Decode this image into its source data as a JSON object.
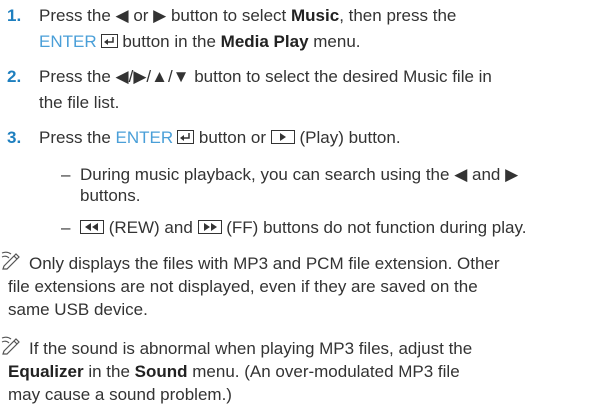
{
  "steps": [
    {
      "number": "1.",
      "line1_a": "Press the ◀ or ▶ button to select ",
      "line1_b": "Music",
      "line1_c": ", then press the",
      "line2_enter": "ENTER",
      "line2_a": " button in the ",
      "line2_b": "Media Play",
      "line2_c": " menu."
    },
    {
      "number": "2.",
      "line1": "Press the ◀/▶/▲/▼ button to select the desired Music file in",
      "line2": "the file list."
    },
    {
      "number": "3.",
      "line1_a": "Press the ",
      "line1_enter": "ENTER",
      "line1_b": " button or ",
      "line1_c": " (Play) button."
    }
  ],
  "sub_bullets": [
    {
      "dash": "–",
      "line1": "During music playback, you can search using the ◀ and ▶",
      "line2": "buttons."
    },
    {
      "dash": "–",
      "line1_rew": " (REW) and ",
      "line1_ff": " (FF) buttons do not function during play."
    }
  ],
  "notes": [
    {
      "icon": "note-pencil-icon",
      "line1": "Only displays the files with MP3 and PCM file extension. Other",
      "line2": "file extensions are not displayed, even if they are saved on the",
      "line3": "same USB device."
    },
    {
      "icon": "note-pencil-icon",
      "line1": "If the sound is abnormal when playing MP3 files, adjust the",
      "line2_a": "Equalizer",
      "line2_b": " in the ",
      "line2_c": "Sound",
      "line2_d": " menu. (An over-modulated MP3 file",
      "line3": "may cause a sound problem.)"
    }
  ],
  "colors": {
    "step_number": "#1e7fbf",
    "enter_keyword": "#4a9fd8",
    "text": "#333333"
  }
}
